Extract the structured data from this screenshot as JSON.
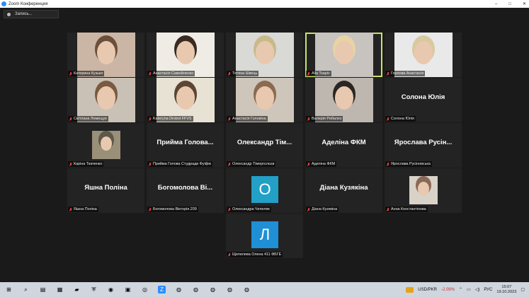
{
  "window": {
    "title": "Zoom Конференция",
    "controls": [
      "–",
      "□",
      "✕"
    ]
  },
  "record_button": {
    "label": "Запись..."
  },
  "tiles": [
    {
      "name": "Катерина Кузько",
      "type": "video",
      "bg": "#cbb6a5",
      "accent": "#6b4f3a"
    },
    {
      "name": "Анастасія Самойленко",
      "type": "video",
      "bg": "#efece6",
      "accent": "#3a2b22"
    },
    {
      "name": "Тетяна Швець",
      "type": "video",
      "bg": "#d9d9d6",
      "accent": "#c9b98a"
    },
    {
      "name": "Alla Tsapiv",
      "type": "video",
      "bg": "#c7c4bf",
      "accent": "#e7d3a6",
      "speaking": true
    },
    {
      "name": "Горлова Анастасія",
      "type": "video",
      "bg": "#e9e9e9",
      "accent": "#d8c9a0"
    },
    {
      "name": "Світлана Лемещук",
      "type": "video",
      "bg": "#cac1b6",
      "accent": "#7a5a40"
    },
    {
      "name": "Kateryna Drobot FFVS",
      "type": "video",
      "bg": "#e8e2d5",
      "accent": "#5c4533"
    },
    {
      "name": "Анастасія Головіна",
      "type": "video",
      "bg": "#cfc6bb",
      "accent": "#8a6a50"
    },
    {
      "name": "Валерія Рибалко",
      "type": "video",
      "bg": "#bdb7b0",
      "accent": "#2c2622"
    },
    {
      "name": "Солона Юлія",
      "type": "name",
      "big": "Солона Юлія"
    },
    {
      "name": "Каріна Ткаченко",
      "type": "image",
      "bg": "#9a8f78",
      "accent": "#5d5847"
    },
    {
      "name": "Прийма Голова Студради Фуіфж",
      "type": "name",
      "big": "Прийма Голова..."
    },
    {
      "name": "Олександр Тімергєлєєв",
      "type": "name",
      "big": "Олександр Тім..."
    },
    {
      "name": "Аделіна ФКМ",
      "type": "name",
      "big": "Аделіна ФКМ"
    },
    {
      "name": "Ярослава Русіновська",
      "type": "name",
      "big": "Ярослава Русін..."
    },
    {
      "name": "Яшна Поліна",
      "type": "name",
      "big": "Яшна Поліна"
    },
    {
      "name": "Богомолова Вікторія.209",
      "type": "name",
      "big": "Богомолова Ві..."
    },
    {
      "name": "Олександра Чепеляк",
      "type": "avatar",
      "letter": "О",
      "color": "#22a0c6"
    },
    {
      "name": "Діана Кузякіна",
      "type": "name",
      "big": "Діана Кузякіна"
    },
    {
      "name": "Анна Константінова",
      "type": "image",
      "bg": "#d9d2c8",
      "accent": "#8a6a56"
    },
    {
      "name": "Щепелева Олена 411 ФБГЕ",
      "type": "avatar",
      "letter": "Л",
      "color": "#1f8fd6"
    }
  ],
  "taskbar": {
    "icons": [
      {
        "name": "windows-start-icon",
        "glyph": "⊞"
      },
      {
        "name": "search-icon",
        "glyph": "⌕"
      },
      {
        "name": "task-view-icon",
        "glyph": "▤"
      },
      {
        "name": "store-icon",
        "glyph": "▦"
      },
      {
        "name": "explorer-icon",
        "glyph": "▰"
      },
      {
        "name": "defender-icon",
        "glyph": "⛨"
      },
      {
        "name": "viber-icon",
        "glyph": "◉"
      },
      {
        "name": "app-icon",
        "glyph": "▣"
      },
      {
        "name": "whatsapp-icon",
        "glyph": "◎"
      },
      {
        "name": "zoom-icon",
        "glyph": "Z"
      },
      {
        "name": "chrome-icon",
        "glyph": "◍"
      },
      {
        "name": "chrome-icon-2",
        "glyph": "◍"
      },
      {
        "name": "chrome-icon-3",
        "glyph": "◍"
      },
      {
        "name": "chrome-icon-4",
        "glyph": "◍"
      },
      {
        "name": "chrome-icon-5",
        "glyph": "◍"
      }
    ],
    "ticker": {
      "pair": "USD/PKR",
      "change": "-2.09%"
    },
    "lang": "РУС",
    "time": "15:07",
    "date": "19.10.2023"
  }
}
